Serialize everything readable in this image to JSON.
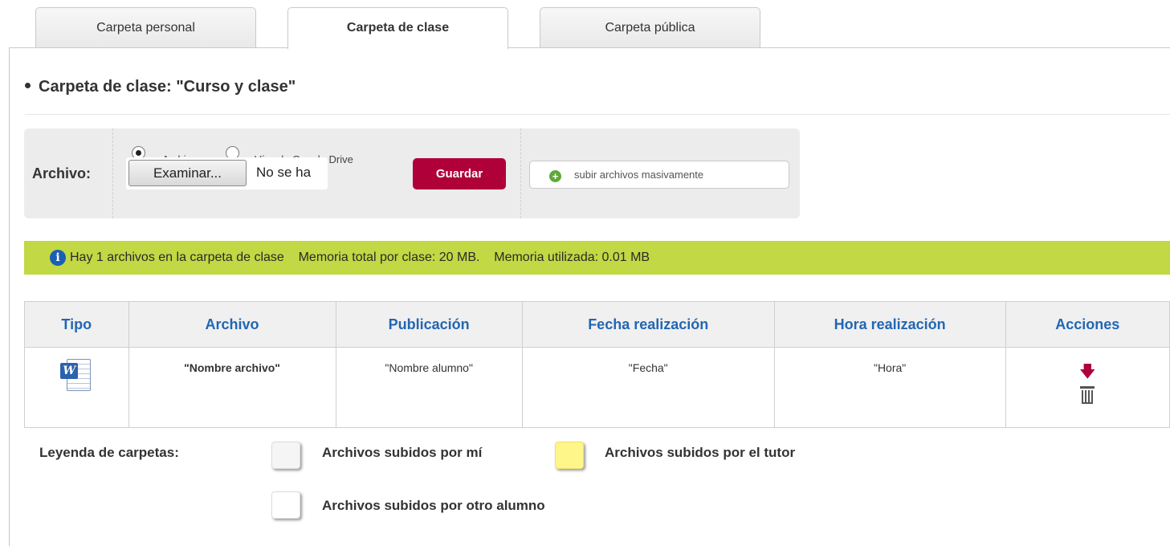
{
  "tabs": [
    {
      "label": "Carpeta personal"
    },
    {
      "label": "Carpeta de clase"
    },
    {
      "label": "Carpeta pública"
    }
  ],
  "heading": "Carpeta de clase: \"Curso y clase\"",
  "upload": {
    "label": "Archivo:",
    "radio_file_label": "Archivo",
    "radio_drive_label": "Vínculo Google Drive",
    "browse_label": "Examinar...",
    "no_file_text": "No se ha",
    "save_label": "Guardar",
    "bulk_label": "subir archivos masivamente"
  },
  "info": {
    "text": "Hay 1 archivos en la carpeta de clase    Memoria total por clase: 20 MB.    Memoria utilizada: 0.01 MB"
  },
  "table": {
    "headers": [
      "Tipo",
      "Archivo",
      "Publicación",
      "Fecha realización",
      "Hora realización",
      "Acciones"
    ],
    "rows": [
      {
        "type_icon": "word-document-icon",
        "file": "\"Nombre archivo\"",
        "publication": "\"Nombre alumno\"",
        "date": "\"Fecha\"",
        "time": "\"Hora\""
      }
    ]
  },
  "legend": {
    "title": "Leyenda de carpetas:",
    "items": [
      {
        "label": "Archivos subidos por mí",
        "color": "#f5f5f5"
      },
      {
        "label": "Archivos subidos por el tutor",
        "color": "#fff68a"
      },
      {
        "label": "Archivos subidos por otro alumno",
        "color": "#ffffff"
      }
    ]
  },
  "colors": {
    "accent": "#b0003a",
    "info_bar": "#c2d844",
    "header_text": "#2266b3"
  }
}
